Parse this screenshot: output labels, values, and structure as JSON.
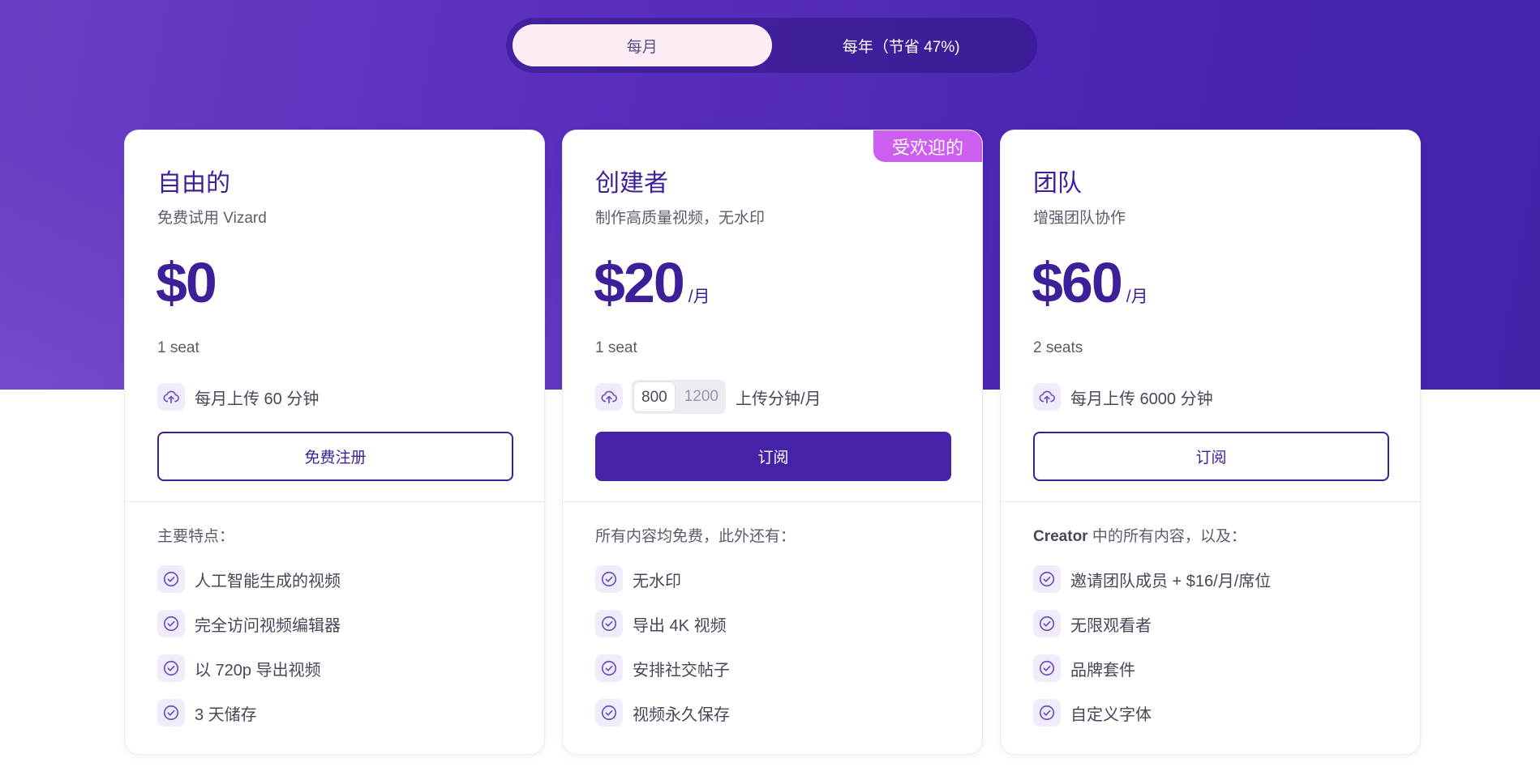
{
  "toggle": {
    "monthly": "每月",
    "yearly": "每年（节省 47%)"
  },
  "colors": {
    "hero": "#5a30bd",
    "accent": "#3e1f9a",
    "badge": "#cd5ef0",
    "button_filled": "#4522a8"
  },
  "plans": [
    {
      "name": "自由的",
      "description": "免费试用 Vizard",
      "price": "$0",
      "per": "",
      "seats": "1 seat",
      "upload": "每月上传 60 分钟",
      "cta": "免费注册",
      "features_title": "主要特点：",
      "features": [
        "人工智能生成的视频",
        "完全访问视频编辑器",
        "以 720p 导出视频",
        "3 天储存"
      ]
    },
    {
      "name": "创建者",
      "badge": "受欢迎的",
      "description": "制作高质量视频，无水印",
      "price": "$20",
      "per": "/月",
      "seats": "1 seat",
      "minute_options": [
        "800",
        "1200"
      ],
      "upload_suffix": "上传分钟/月",
      "cta": "订阅",
      "features_title": "所有内容均免费，此外还有：",
      "features": [
        "无水印",
        "导出 4K 视频",
        "安排社交帖子",
        "视频永久保存"
      ]
    },
    {
      "name": "团队",
      "description": "增强团队协作",
      "price": "$60",
      "per": "/月",
      "seats": "2 seats",
      "upload": "每月上传 6000 分钟",
      "cta": "订阅",
      "features_title_bold": "Creator",
      "features_title": " 中的所有内容，以及：",
      "features": [
        "邀请团队成员 + $16/月/席位",
        "无限观看者",
        "品牌套件",
        "自定义字体"
      ]
    }
  ],
  "icons": {
    "upload": "cloud-upload-icon",
    "check": "check-circle-icon"
  }
}
